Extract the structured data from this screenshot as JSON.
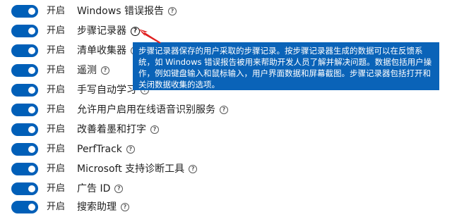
{
  "toggle_state_label": "开启",
  "items": [
    {
      "label": "Windows 错误报告"
    },
    {
      "label": "步骤记录器"
    },
    {
      "label": "清单收集器"
    },
    {
      "label": "遥测"
    },
    {
      "label": "手写自动学习"
    },
    {
      "label": "允许用户启用在线语音识别服务"
    },
    {
      "label": "改善着墨和打字"
    },
    {
      "label": "PerfTrack"
    },
    {
      "label": "Microsoft 支持诊断工具"
    },
    {
      "label": "广告 ID"
    },
    {
      "label": "搜索助理"
    }
  ],
  "help_glyph": "?",
  "tooltip": {
    "text": "步骤记录器保存的用户采取的步骤记录。按步骤记录器生成的数据可以在反馈系统，如 Windows 错误报告被用来帮助开发人员了解并解决问题。数据包括用户操作，例如键盘输入和鼠标输入，用户界面数据和屏幕截图。步骤记录器包括打开和关闭数据收集的选项。"
  },
  "colors": {
    "toggle_on": "#005fb8",
    "tooltip_bg": "#0a63b8",
    "pointer_arrow": "#e02020"
  }
}
